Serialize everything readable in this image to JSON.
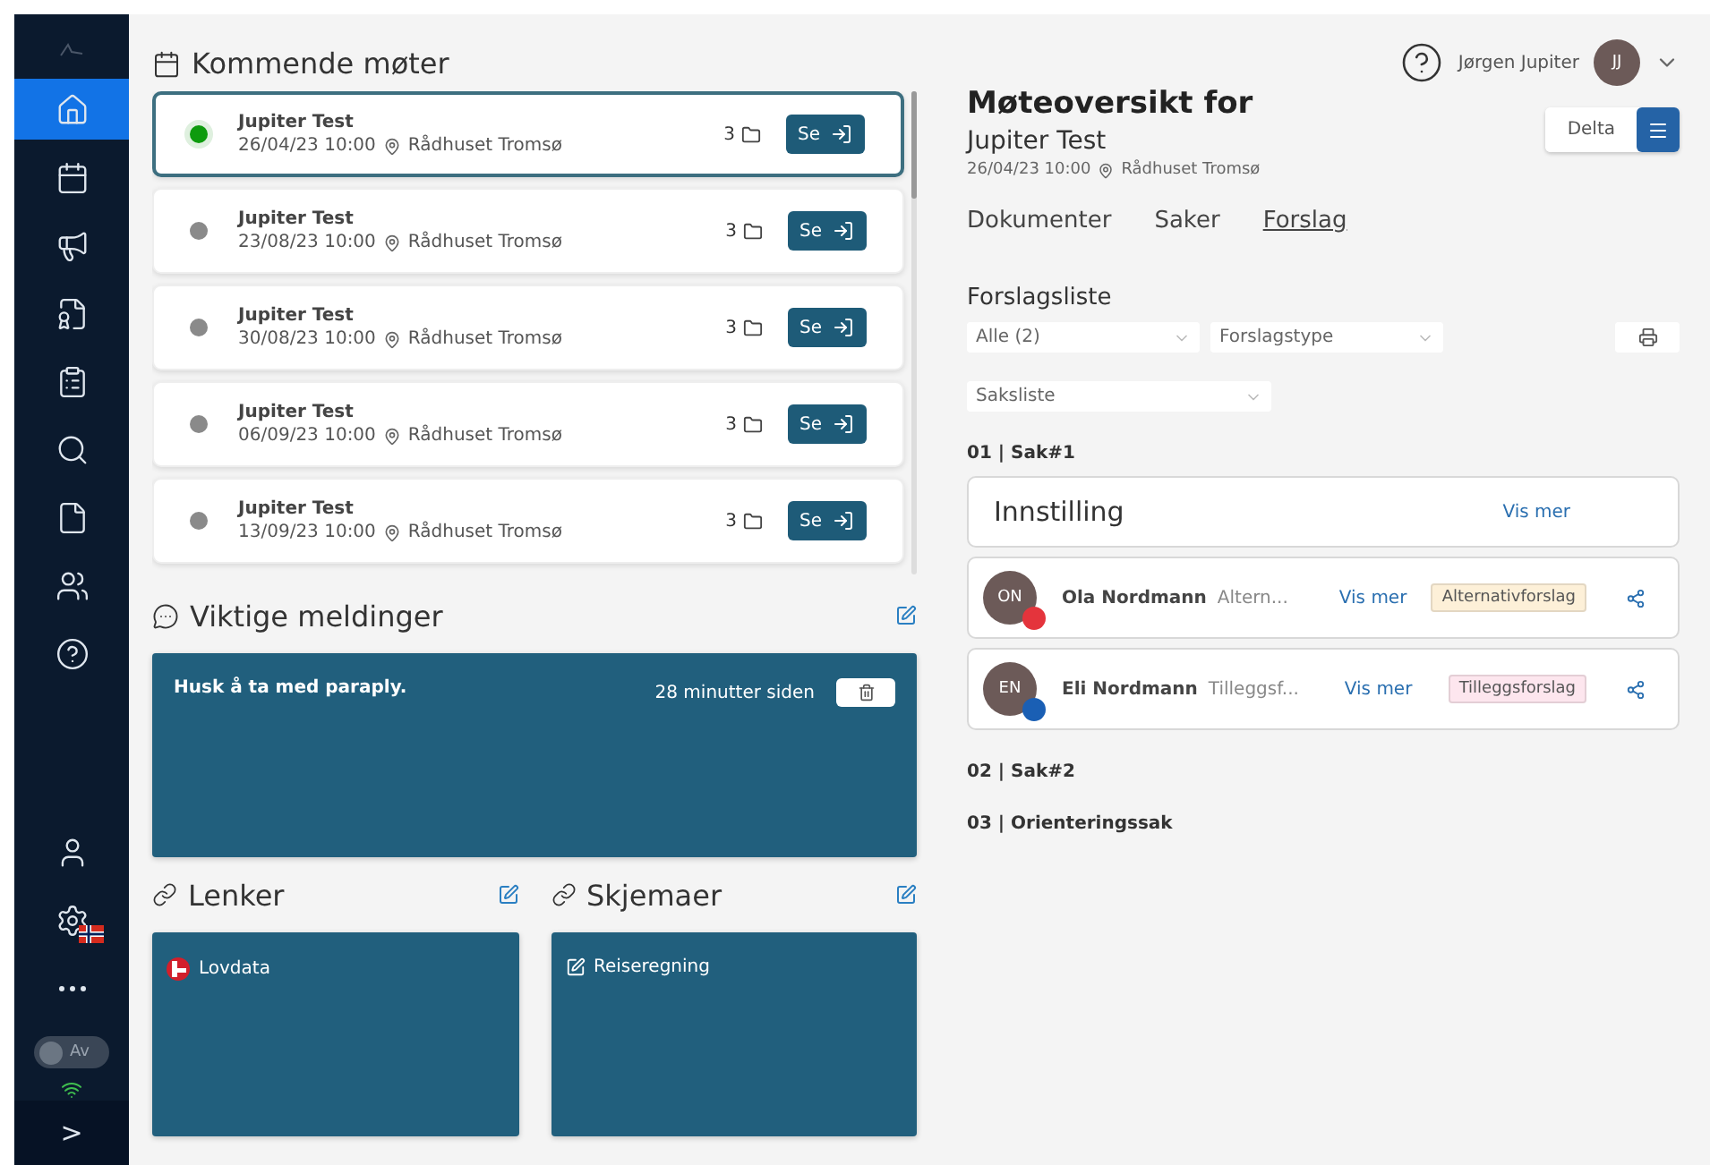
{
  "sidebar": {
    "nav": [
      {
        "kind": "home",
        "selected": true
      },
      {
        "kind": "calendar",
        "selected": false
      },
      {
        "kind": "megaphone",
        "selected": false
      },
      {
        "kind": "certificate",
        "selected": false
      },
      {
        "kind": "document-list",
        "selected": false
      },
      {
        "kind": "search",
        "selected": false
      },
      {
        "kind": "file",
        "selected": false
      },
      {
        "kind": "users",
        "selected": false
      },
      {
        "kind": "help",
        "selected": false
      }
    ],
    "bottom": [
      {
        "kind": "user"
      },
      {
        "kind": "settings"
      },
      {
        "kind": "more"
      }
    ],
    "toggle": {
      "label": "Av",
      "on": false
    },
    "expand": ">"
  },
  "meetings": {
    "title": "Kommende møter",
    "items": [
      {
        "title": "Jupiter Test",
        "date": "26/04/23 10:00",
        "location": "Rådhuset Tromsø",
        "count": "3",
        "button": "Se",
        "selected": true
      },
      {
        "title": "Jupiter Test",
        "date": "23/08/23 10:00",
        "location": "Rådhuset Tromsø",
        "count": "3",
        "button": "Se",
        "selected": false
      },
      {
        "title": "Jupiter Test",
        "date": "30/08/23 10:00",
        "location": "Rådhuset Tromsø",
        "count": "3",
        "button": "Se",
        "selected": false
      },
      {
        "title": "Jupiter Test",
        "date": "06/09/23 10:00",
        "location": "Rådhuset Tromsø",
        "count": "3",
        "button": "Se",
        "selected": false
      },
      {
        "title": "Jupiter Test",
        "date": "13/09/23 10:00",
        "location": "Rådhuset Tromsø",
        "count": "3",
        "button": "Se",
        "selected": false
      }
    ]
  },
  "messages": {
    "title": "Viktige meldinger",
    "items": [
      {
        "text": "Husk å ta med paraply.",
        "time": "28 minutter siden"
      }
    ]
  },
  "links": {
    "title": "Lenker",
    "items": [
      {
        "label": "Lovdata"
      }
    ]
  },
  "forms": {
    "title": "Skjemaer",
    "items": [
      {
        "label": "Reiseregning"
      }
    ]
  },
  "header": {
    "user": "Jørgen Jupiter",
    "initials": "JJ"
  },
  "overview": {
    "title": "Møteoversikt for",
    "meeting": "Jupiter Test",
    "date": "26/04/23 10:00",
    "location": "Rådhuset Tromsø",
    "share_button": "Delta",
    "tabs": [
      {
        "label": "Dokumenter",
        "selected": false
      },
      {
        "label": "Saker",
        "selected": false
      },
      {
        "label": "Forslag",
        "selected": true
      }
    ],
    "list_title": "Forslagsliste",
    "filters": [
      {
        "value": "Alle (2)"
      },
      {
        "placeholder": "Forslagstype"
      },
      {
        "placeholder": "Saksliste"
      }
    ],
    "cases": [
      {
        "heading": "01 | Sak#1",
        "recommendation": {
          "title": "Innstilling",
          "link": "Vis mer"
        },
        "proposals": [
          {
            "avatar": {
              "initials": "ON",
              "color": "#e4343c"
            },
            "name": "Ola Nordmann",
            "excerpt": "Altern...",
            "link": "Vis mer",
            "tag": {
              "label": "Alternativforslag",
              "color": "#fdf0d8"
            }
          },
          {
            "avatar": {
              "initials": "EN",
              "color": "#1a5fb4"
            },
            "name": "Eli Nordmann",
            "excerpt": "Tilleggsf...",
            "link": "Vis mer",
            "tag": {
              "label": "Tilleggsforslag",
              "color": "#fde6ee"
            }
          }
        ]
      },
      {
        "heading": "02 | Sak#2"
      },
      {
        "heading": "03 | Orienteringssak"
      }
    ]
  }
}
